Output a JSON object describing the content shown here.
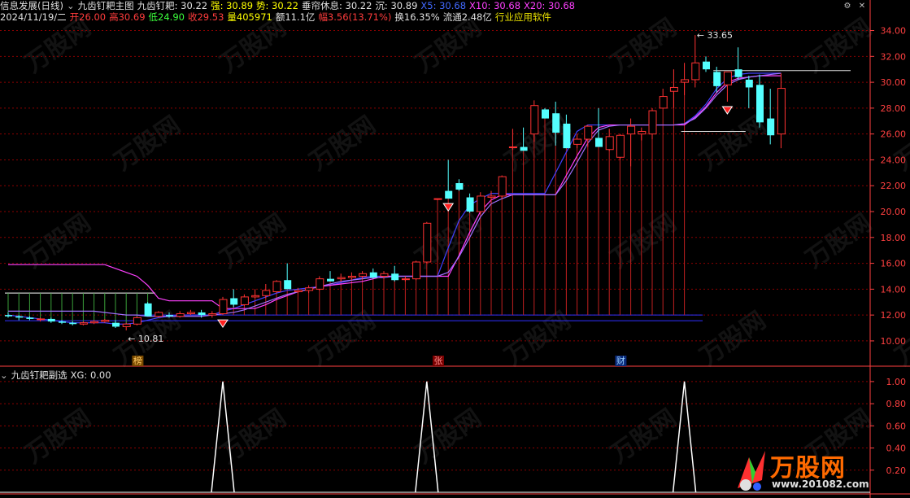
{
  "header": {
    "line1": [
      {
        "text": "信息发展(日线)",
        "color": "white"
      },
      {
        "text": "⌄",
        "color": "gray"
      },
      {
        "text": "九齿钉耙主图",
        "color": "white"
      },
      {
        "text": "九齿钉耙: 30.22",
        "color": "white"
      },
      {
        "text": "强: 30.89",
        "color": "yellow"
      },
      {
        "text": "势: 30.22",
        "color": "yellow"
      },
      {
        "text": "垂帘休息: 30.22",
        "color": "white"
      },
      {
        "text": "沉: 30.89",
        "color": "white"
      },
      {
        "text": "X5: 30.68",
        "color": "blue"
      },
      {
        "text": "X10: 30.68",
        "color": "magenta"
      },
      {
        "text": "X20: 30.68",
        "color": "magenta"
      }
    ],
    "line2": [
      {
        "text": "2024/11/19/二",
        "color": "white"
      },
      {
        "text": "开26.00",
        "color": "red"
      },
      {
        "text": "高30.69",
        "color": "red"
      },
      {
        "text": "低24.90",
        "color": "green"
      },
      {
        "text": "收29.53",
        "color": "red"
      },
      {
        "text": "量405971",
        "color": "yellow"
      },
      {
        "text": "额11.1亿",
        "color": "white"
      },
      {
        "text": "幅3.56(13.71%)",
        "color": "red"
      },
      {
        "text": "换16.35%",
        "color": "white"
      },
      {
        "text": "流通2.48亿",
        "color": "white"
      },
      {
        "text": "行业应用软件",
        "color": "ylw2"
      }
    ],
    "sub_line": [
      {
        "text": "⌄",
        "color": "gray"
      },
      {
        "text": "九齿钉耙副选",
        "color": "white"
      },
      {
        "text": "XG: 0.00",
        "color": "white"
      }
    ]
  },
  "icons": {
    "settings": "gear-icon",
    "close": "close-icon",
    "collapse": "chevron-down-icon"
  },
  "markers": [
    {
      "label": "榜",
      "index": 12,
      "bg": "#7a4a00",
      "fg": "#ffcc66"
    },
    {
      "label": "张",
      "index": 40,
      "bg": "#7a0000",
      "fg": "#ff9090"
    },
    {
      "label": "财",
      "index": 57,
      "bg": "#0a2a7a",
      "fg": "#9ad0ff"
    }
  ],
  "annotations": [
    {
      "text": "33.65",
      "index": 64,
      "value": 33.65
    },
    {
      "text": "10.81",
      "index": 11,
      "value": 10.81
    }
  ],
  "watermark": {
    "text": "万股网",
    "site": "www.201082.com"
  },
  "colors": {
    "up": "#ff3232",
    "down": "#54ffff",
    "grid": "#8b0000",
    "axis": "#ff4040",
    "bg": "#000000"
  },
  "chart_data": [
    {
      "type": "candlestick",
      "title": "九齿钉耙主图",
      "ylim": [
        8.8,
        34.6
      ],
      "yticks": [
        10,
        12,
        14,
        16,
        18,
        20,
        22,
        24,
        26,
        28,
        30,
        32,
        34
      ],
      "ytick_labels": [
        "10.00",
        "12.00",
        "14.00",
        "16.00",
        "18.00",
        "20.00",
        "22.00",
        "24.00",
        "26.00",
        "28.00",
        "30.00",
        "32.00",
        "34.00"
      ],
      "ohlc": [
        [
          12.0,
          12.2,
          11.8,
          11.9
        ],
        [
          11.9,
          12.0,
          11.6,
          11.8
        ],
        [
          11.8,
          11.9,
          11.6,
          11.7
        ],
        [
          11.7,
          11.8,
          11.5,
          11.7
        ],
        [
          11.7,
          11.8,
          11.4,
          11.5
        ],
        [
          11.5,
          11.6,
          11.3,
          11.4
        ],
        [
          11.4,
          11.5,
          11.2,
          11.3
        ],
        [
          11.3,
          11.5,
          11.2,
          11.4
        ],
        [
          11.4,
          11.6,
          11.3,
          11.5
        ],
        [
          11.5,
          11.7,
          11.4,
          11.6
        ],
        [
          11.4,
          11.6,
          11.0,
          11.1
        ],
        [
          11.1,
          11.4,
          10.81,
          11.3
        ],
        [
          11.3,
          11.9,
          11.2,
          11.8
        ],
        [
          12.9,
          13.0,
          11.9,
          11.9
        ],
        [
          11.9,
          12.3,
          11.8,
          12.2
        ],
        [
          12.0,
          12.2,
          11.8,
          11.9
        ],
        [
          11.9,
          12.3,
          11.8,
          12.1
        ],
        [
          12.1,
          12.4,
          12.0,
          12.2
        ],
        [
          12.2,
          12.4,
          11.8,
          12.0
        ],
        [
          12.0,
          12.3,
          11.8,
          12.1
        ],
        [
          12.1,
          13.4,
          12.0,
          13.2
        ],
        [
          13.3,
          14.0,
          12.6,
          12.8
        ],
        [
          12.8,
          13.6,
          12.7,
          13.4
        ],
        [
          13.4,
          14.0,
          13.3,
          13.5
        ],
        [
          13.5,
          14.4,
          13.3,
          13.9
        ],
        [
          13.8,
          14.7,
          13.7,
          14.6
        ],
        [
          14.7,
          16.0,
          14.0,
          14.0
        ],
        [
          13.8,
          14.1,
          13.7,
          13.9
        ],
        [
          13.9,
          14.3,
          13.7,
          14.1
        ],
        [
          14.0,
          15.0,
          13.9,
          14.8
        ],
        [
          14.8,
          15.4,
          14.6,
          14.6
        ],
        [
          14.8,
          15.2,
          14.6,
          14.9
        ],
        [
          14.9,
          15.3,
          14.7,
          15.0
        ],
        [
          15.0,
          15.4,
          14.8,
          15.2
        ],
        [
          15.3,
          15.6,
          14.8,
          14.9
        ],
        [
          15.0,
          15.4,
          14.8,
          15.2
        ],
        [
          15.2,
          15.8,
          14.6,
          14.7
        ],
        [
          14.8,
          15.0,
          14.6,
          14.8
        ],
        [
          14.8,
          16.2,
          14.7,
          16.1
        ],
        [
          16.1,
          19.2,
          16.0,
          19.1
        ],
        [
          21.0,
          21.0,
          20.9,
          21.0
        ],
        [
          21.6,
          24.0,
          21.0,
          21.0
        ],
        [
          22.2,
          22.5,
          21.6,
          21.7
        ],
        [
          21.1,
          21.4,
          19.9,
          20.0
        ],
        [
          20.0,
          21.5,
          19.8,
          21.2
        ],
        [
          21.1,
          21.6,
          20.6,
          21.2
        ],
        [
          21.2,
          22.8,
          21.0,
          22.7
        ],
        [
          25.0,
          26.4,
          24.8,
          25.0
        ],
        [
          25.0,
          26.5,
          24.7,
          24.7
        ],
        [
          26.0,
          28.6,
          25.4,
          28.2
        ],
        [
          27.9,
          28.0,
          27.2,
          27.2
        ],
        [
          27.6,
          28.5,
          25.1,
          26.1
        ],
        [
          26.8,
          27.5,
          24.9,
          24.9
        ],
        [
          25.2,
          26.0,
          24.9,
          25.6
        ],
        [
          25.6,
          26.7,
          25.0,
          26.6
        ],
        [
          25.7,
          28.0,
          25.0,
          25.0
        ],
        [
          24.8,
          26.4,
          24.7,
          25.8
        ],
        [
          24.2,
          26.0,
          24.0,
          25.9
        ],
        [
          26.0,
          27.2,
          23.5,
          26.6
        ],
        [
          26.0,
          26.5,
          25.5,
          26.2
        ],
        [
          26.0,
          28.0,
          25.6,
          27.8
        ],
        [
          28.0,
          29.5,
          28.0,
          28.9
        ],
        [
          29.3,
          31.0,
          28.0,
          29.6
        ],
        [
          30.0,
          31.5,
          29.0,
          30.2
        ],
        [
          30.2,
          33.65,
          29.6,
          31.5
        ],
        [
          31.6,
          32.0,
          30.8,
          31.0
        ],
        [
          30.8,
          31.2,
          29.2,
          29.7
        ],
        [
          29.8,
          30.8,
          28.5,
          30.8
        ],
        [
          31.0,
          32.7,
          30.2,
          30.4
        ],
        [
          30.2,
          30.5,
          28.0,
          29.6
        ],
        [
          29.8,
          30.6,
          26.5,
          26.9
        ],
        [
          27.2,
          29.5,
          25.2,
          25.9
        ],
        [
          26.0,
          30.69,
          24.9,
          29.53
        ]
      ],
      "series": [
        {
          "name": "X5",
          "color": "#4040ff",
          "values": [
            12.0,
            11.9,
            11.8,
            11.7,
            11.6,
            11.5,
            11.4,
            11.4,
            11.4,
            11.4,
            11.3,
            11.3,
            11.4,
            11.6,
            11.8,
            11.9,
            12.0,
            12.0,
            12.0,
            12.0,
            12.3,
            12.5,
            12.8,
            13.1,
            13.4,
            13.7,
            13.9,
            14.0,
            14.1,
            14.2,
            14.3,
            14.5,
            14.7,
            14.9,
            15.0,
            15.0,
            15.0,
            15.0,
            15.0,
            15.0,
            15.0,
            17.2,
            19.3,
            20.5,
            21.0,
            21.4,
            21.4,
            21.4,
            21.4,
            21.4,
            21.4,
            23.0,
            24.6,
            26.2,
            26.7,
            26.7,
            26.7,
            26.7,
            26.7,
            26.7,
            26.7,
            26.7,
            26.7,
            26.8,
            27.4,
            28.3,
            29.5,
            30.3,
            30.6,
            30.7,
            30.7,
            30.7,
            30.7
          ]
        },
        {
          "name": "X10",
          "color": "#ff40ff",
          "values": [
            15.9,
            15.9,
            15.9,
            15.9,
            15.9,
            15.9,
            15.9,
            15.9,
            15.9,
            15.9,
            15.6,
            15.3,
            15.0,
            14.3,
            13.3,
            13.1,
            13.1,
            13.1,
            13.1,
            13.1,
            12.5,
            12.5,
            12.5,
            12.5,
            12.8,
            13.2,
            13.5,
            13.8,
            14.0,
            14.2,
            14.3,
            14.4,
            14.5,
            14.6,
            14.8,
            15.0,
            15.0,
            15.0,
            15.0,
            15.0,
            15.0,
            15.0,
            16.6,
            18.4,
            20.0,
            20.9,
            21.3,
            21.3,
            21.3,
            21.3,
            21.3,
            21.3,
            22.8,
            24.3,
            25.7,
            26.5,
            26.7,
            26.7,
            26.7,
            26.7,
            26.7,
            26.7,
            26.7,
            26.7,
            27.3,
            28.1,
            29.2,
            30.0,
            30.3,
            30.4,
            30.5,
            30.5,
            30.5
          ]
        },
        {
          "name": "X20",
          "color": "#a070ff",
          "values": [
            12.3,
            12.3,
            12.3,
            12.3,
            12.3,
            12.3,
            12.3,
            12.3,
            12.3,
            12.2,
            12.1,
            12.0,
            12.0,
            11.9,
            11.9,
            11.9,
            11.9,
            11.9,
            11.9,
            12.0,
            12.1,
            12.2,
            12.4,
            12.7,
            13.0,
            13.3,
            13.6,
            13.8,
            14.0,
            14.2,
            14.4,
            14.6,
            14.7,
            14.8,
            14.9,
            14.9,
            15.0,
            15.0,
            15.0,
            15.0,
            15.0,
            15.3,
            16.5,
            18.0,
            19.6,
            20.6,
            21.0,
            21.3,
            21.3,
            21.3,
            21.3,
            21.3,
            22.4,
            23.8,
            25.3,
            26.3,
            26.6,
            26.7,
            26.7,
            26.7,
            26.7,
            26.7,
            26.7,
            26.8,
            27.2,
            28.0,
            29.0,
            29.8,
            30.2,
            30.4,
            30.5,
            30.6,
            30.7
          ]
        }
      ]
    },
    {
      "type": "line",
      "title": "九齿钉耙副选",
      "series_name": "XG",
      "ylim": [
        0,
        1.08
      ],
      "yticks": [
        0.2,
        0.4,
        0.6,
        0.8,
        1.0
      ],
      "ytick_labels": [
        "0.20",
        "0.40",
        "0.60",
        "0.80",
        "1.00"
      ],
      "spikes": [
        20,
        39,
        63
      ],
      "current": 0.0
    }
  ]
}
